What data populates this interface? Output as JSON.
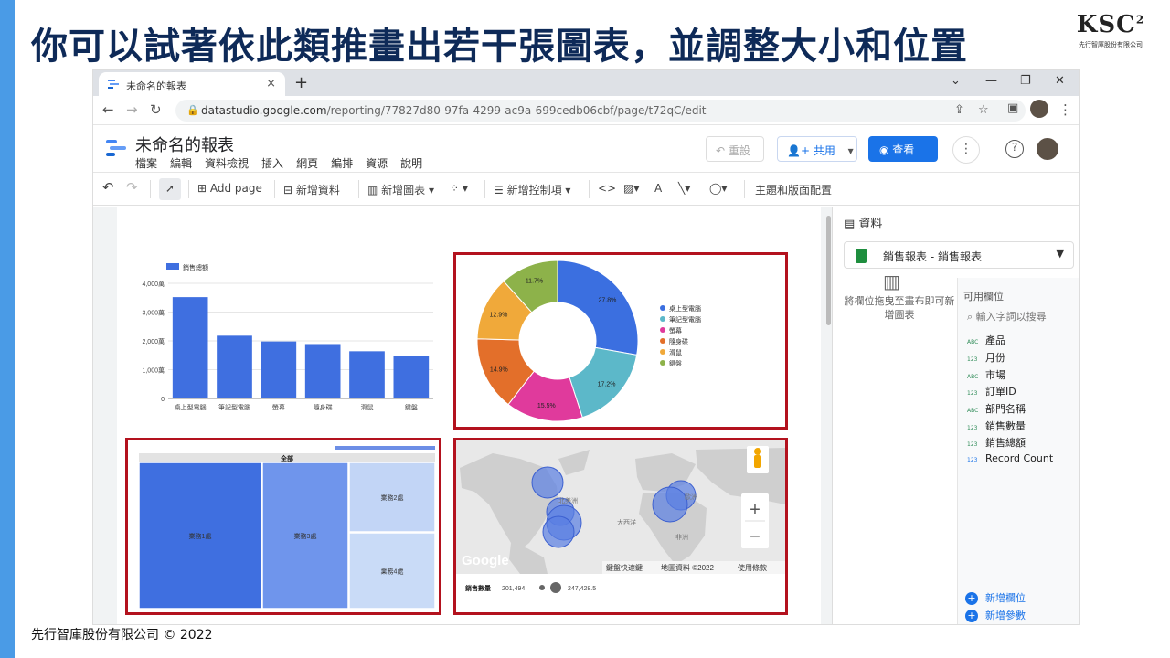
{
  "slide": {
    "title": "你可以試著依此類推畫出若干張圖表，並調整大小和位置",
    "logo_text": "KSC",
    "logo_sup": "2",
    "logo_company": "先行智庫股份有限公司",
    "footer": "先行智庫股份有限公司 © 2022"
  },
  "browser": {
    "tab_title": "未命名的報表",
    "tab_close": "×",
    "new_tab": "+",
    "url_domain": "datastudio.google.com",
    "url_path": "/reporting/77827d80-97fa-4299-ac9a-699cedb06cbf/page/t72qC/edit"
  },
  "app": {
    "report_title": "未命名的報表",
    "menu": [
      "檔案",
      "編輯",
      "資料檢視",
      "插入",
      "網頁",
      "編排",
      "資源",
      "說明"
    ],
    "reset_label": "重設",
    "share_label": "共用",
    "view_label": "查看",
    "help_icon": "help-icon"
  },
  "toolbar": {
    "add_page": "Add page",
    "add_data": "新增資料",
    "add_chart": "新增圖表",
    "add_control": "新增控制項",
    "theme_layout": "主題和版面配置"
  },
  "data_panel": {
    "title": "資料",
    "source": "銷售報表 - 銷售報表",
    "hint": "將欄位拖曳至畫布即可新增圖表",
    "fields_title": "可用欄位",
    "search_placeholder": "輸入字詞以搜尋",
    "fields": [
      {
        "type": "ABC",
        "name": "產品"
      },
      {
        "type": "123",
        "name": "月份"
      },
      {
        "type": "ABC",
        "name": "市場"
      },
      {
        "type": "123",
        "name": "訂單ID"
      },
      {
        "type": "ABC",
        "name": "部門名稱"
      },
      {
        "type": "123",
        "name": "銷售數量"
      },
      {
        "type": "123",
        "name": "銷售總額"
      },
      {
        "type": "123",
        "name": "Record Count"
      }
    ],
    "add_field": "新增欄位",
    "add_param": "新增參數"
  },
  "chart_data": [
    {
      "type": "bar",
      "legend": "銷售總額",
      "categories": [
        "桌上型電腦",
        "筆記型電腦",
        "螢幕",
        "隨身碟",
        "滑鼠",
        "鍵盤"
      ],
      "values": [
        3520,
        2180,
        1980,
        1890,
        1640,
        1480
      ],
      "yticks": [
        "0",
        "1,000萬",
        "2,000萬",
        "3,000萬",
        "4,000萬"
      ],
      "ylim": [
        0,
        4000
      ],
      "bar_color": "#3f6fe0"
    },
    {
      "type": "pie",
      "labels": [
        "桌上型電腦",
        "筆記型電腦",
        "螢幕",
        "隨身碟",
        "滑鼠",
        "鍵盤"
      ],
      "values": [
        27.8,
        17.2,
        15.5,
        14.9,
        12.9,
        11.7
      ],
      "value_labels": [
        "27.8%",
        "17.2%",
        "15.5%",
        "14.9%",
        "12.9%",
        "11.7%"
      ],
      "colors": [
        "#3b6fe0",
        "#5cb8c9",
        "#e03a9c",
        "#e36f2a",
        "#f0a93a",
        "#8db24a"
      ],
      "donut": true
    },
    {
      "type": "treemap",
      "header": "全部",
      "labels": [
        "業務1處",
        "業務3處",
        "業務2處",
        "業務4處"
      ]
    },
    {
      "type": "bubble-map",
      "map_labels": [
        "北美洲",
        "大西洋",
        "非洲",
        "歐洲"
      ],
      "attribution": [
        "鍵盤快速鍵",
        "地圖資料 ©2022",
        "使用條款"
      ],
      "logo": "Google",
      "legend_metric": "銷售數量",
      "legend_min": "201,494",
      "legend_max": "247,428.5",
      "zoom_in": "+",
      "zoom_out": "−"
    }
  ]
}
